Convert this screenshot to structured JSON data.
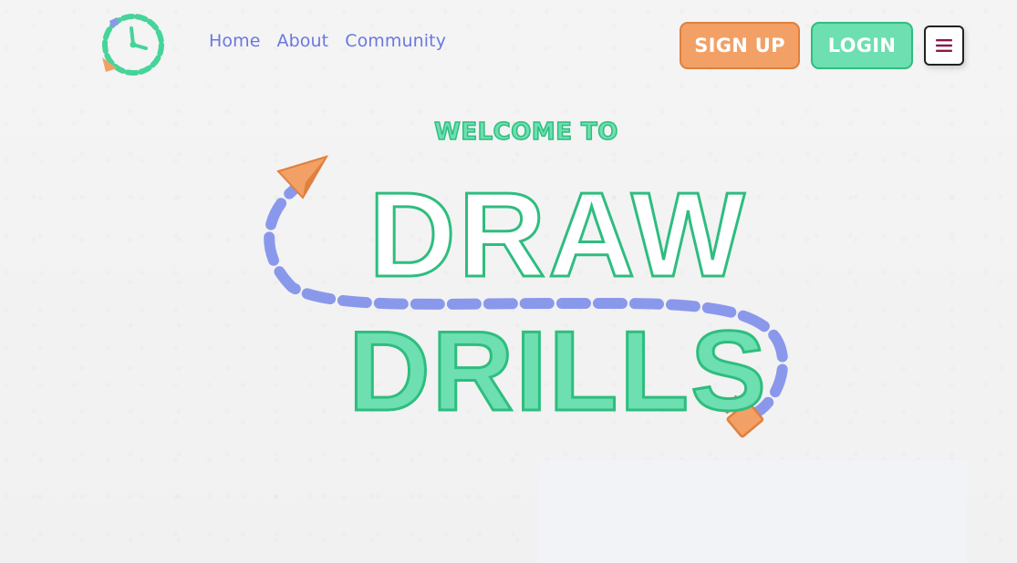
{
  "header": {
    "nav": [
      "Home",
      "About",
      "Community"
    ],
    "signup_label": "SIGN UP",
    "login_label": "LOGIN",
    "menu_icon": "hamburger-menu-icon"
  },
  "hero": {
    "welcome": "WELCOME TO",
    "title_line1": "DRAW",
    "title_line2": "DRILLS"
  },
  "colors": {
    "green": "#6ddfb0",
    "green_dark": "#2ebd7f",
    "orange": "#f2a066",
    "orange_dark": "#e0803c",
    "blue": "#8a98ec",
    "nav_text": "#6b78e0",
    "menu_icon": "#8a1a4a"
  }
}
